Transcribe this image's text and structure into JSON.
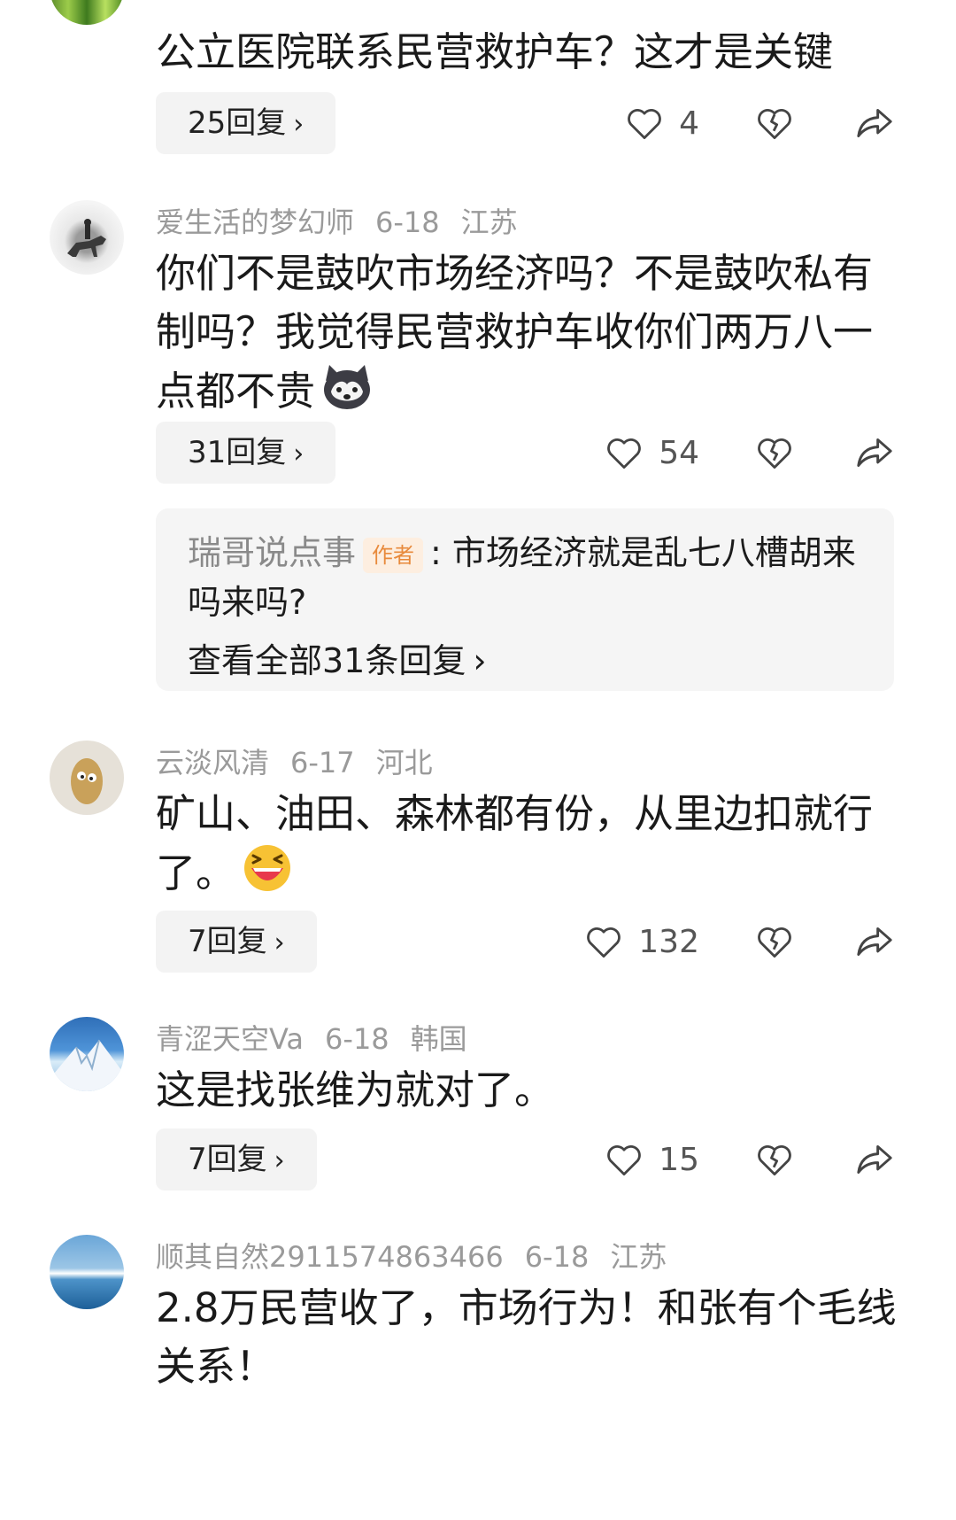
{
  "comments": [
    {
      "author": "",
      "date": "",
      "location": "",
      "text": "公立医院联系民营救护车？这才是关键",
      "replies_label": "25回复",
      "likes": "4"
    },
    {
      "author": "爱生活的梦幻师",
      "date": "6-18",
      "location": "江苏",
      "text": "你们不是鼓吹市场经济吗？不是鼓吹私有制吗？我觉得民营救护车收你们两万八一点都不贵",
      "replies_label": "31回复",
      "likes": "54",
      "sub_reply": {
        "author": "瑞哥说点事",
        "tag": "作者",
        "text": "市场经济就是乱七八槽胡来吗来吗?",
        "view_all": "查看全部31条回复"
      }
    },
    {
      "author": "云淡风清",
      "date": "6-17",
      "location": "河北",
      "text": "矿山、油田、森林都有份，从里边扣就行了。",
      "replies_label": "7回复",
      "likes": "132"
    },
    {
      "author": "青涩天空Va",
      "date": "6-18",
      "location": "韩国",
      "text": "这是找张维为就对了。",
      "replies_label": "7回复",
      "likes": "15"
    },
    {
      "author": "顺其自然2911574863466",
      "date": "6-18",
      "location": "江苏",
      "text": "2.8万民营收了，市场行为！和张有个毛线关系！"
    }
  ],
  "icons": {
    "like": "heart-outline-icon",
    "dislike": "broken-heart-icon",
    "share": "share-arrow-icon",
    "chevron": "chevron-right-icon"
  },
  "colors": {
    "meta": "#9a9a9a",
    "button_bg": "#f3f3f3",
    "author_tag": "#e88a3c"
  }
}
